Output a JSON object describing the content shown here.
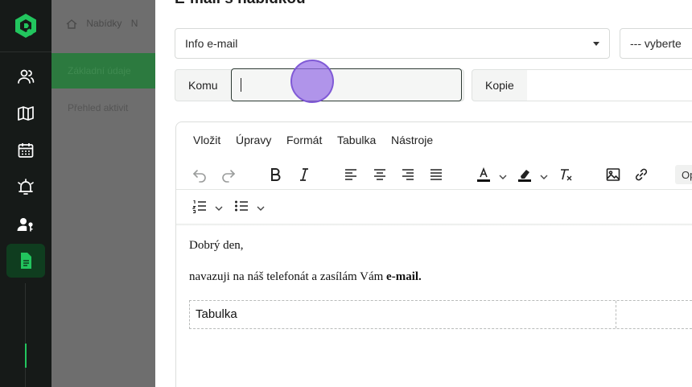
{
  "modal": {
    "title": "E-mail s nabídkou",
    "template_select": {
      "value": "Info e-mail"
    },
    "second_select": {
      "value": "--- vyberte"
    },
    "komu": {
      "label": "Komu",
      "value": ""
    },
    "kopie": {
      "label": "Kopie",
      "value": ""
    }
  },
  "background": {
    "breadcrumb": [
      "Nabídky",
      "N"
    ],
    "tabs": [
      "Základní údaje",
      "Přehled aktivit"
    ]
  },
  "editor": {
    "menu": [
      "Vložit",
      "Úpravy",
      "Formát",
      "Tabulka",
      "Nástroje"
    ],
    "toolbar_more_label": "Op",
    "content": {
      "greeting": "Dobrý den,",
      "body_text": "navazuji na náš telefonát a zasílám Vám ",
      "body_bold": "e-mail.",
      "table_cell": "Tabulka"
    }
  },
  "colors": {
    "rail_bg": "#161a18",
    "accent_green": "#22c55e",
    "touch_indicator": "#9b6fe6"
  },
  "icons": {
    "rail": [
      "logo-icon",
      "users-icon",
      "map-icon",
      "calendar-icon",
      "alarm-icon",
      "user-key-icon",
      "document-icon"
    ]
  }
}
